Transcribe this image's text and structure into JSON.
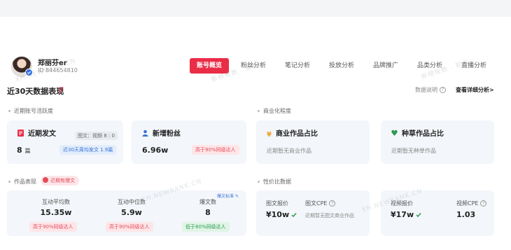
{
  "profile": {
    "name": "郑丽芬er",
    "id": "ID 844654810"
  },
  "tabs": [
    {
      "label": "账号概览",
      "active": true
    },
    {
      "label": "粉丝分析"
    },
    {
      "label": "笔记分析"
    },
    {
      "label": "投放分析"
    },
    {
      "label": "品牌推广"
    },
    {
      "label": "品类分析"
    },
    {
      "label": "直播分析"
    }
  ],
  "section": {
    "title": "近30天数据表现",
    "explain": "数据说明",
    "help_icon": "?",
    "detail_link": "查看详细分析>"
  },
  "recent": {
    "label": "近期账号活跃度",
    "posts": {
      "title": "近期发文",
      "value": "8",
      "unit": "篇",
      "ratio": "图文：视频 8 : 0",
      "badge": "近30天周均发文 1.9篇"
    },
    "fans": {
      "title": "新增粉丝",
      "value": "6.96w",
      "badge": "高于90%同级达人"
    }
  },
  "commercial": {
    "label": "商业化程度",
    "business": {
      "title": "商业作品占比",
      "note": "近期暂无商业作品"
    },
    "grass": {
      "title": "种草作品占比",
      "note": "近期暂无种草作品"
    }
  },
  "works": {
    "label": "作品表现",
    "hot_tag": "近期有爆文",
    "standard": "爆文标准",
    "metrics": [
      {
        "label": "互动平均数",
        "value": "15.35w",
        "badge": "高于90%同级达人",
        "tone": "red"
      },
      {
        "label": "互动中位数",
        "value": "5.9w",
        "badge": "高于90%同级达人",
        "tone": "red"
      },
      {
        "label": "爆文数",
        "value": "8",
        "badge": "低于80%同级达人",
        "tone": "green"
      }
    ]
  },
  "price": {
    "label": "性价比数据",
    "image_price": {
      "label": "图文报价",
      "value": "¥10w"
    },
    "image_cpe": {
      "label": "图文CPE",
      "note": "近期暂无图文商业作品"
    },
    "video_price": {
      "label": "视频报价",
      "value": "¥17w"
    },
    "video_cpe": {
      "label": "视频CPE",
      "value": "1.03"
    }
  },
  "watermark": "XH.NEWRANK.CN",
  "watermark_cn": "新榜有数 · 新红",
  "colors": {
    "accent": "#ea2c47",
    "blue": "#3671d8",
    "green": "#2c9a50"
  }
}
